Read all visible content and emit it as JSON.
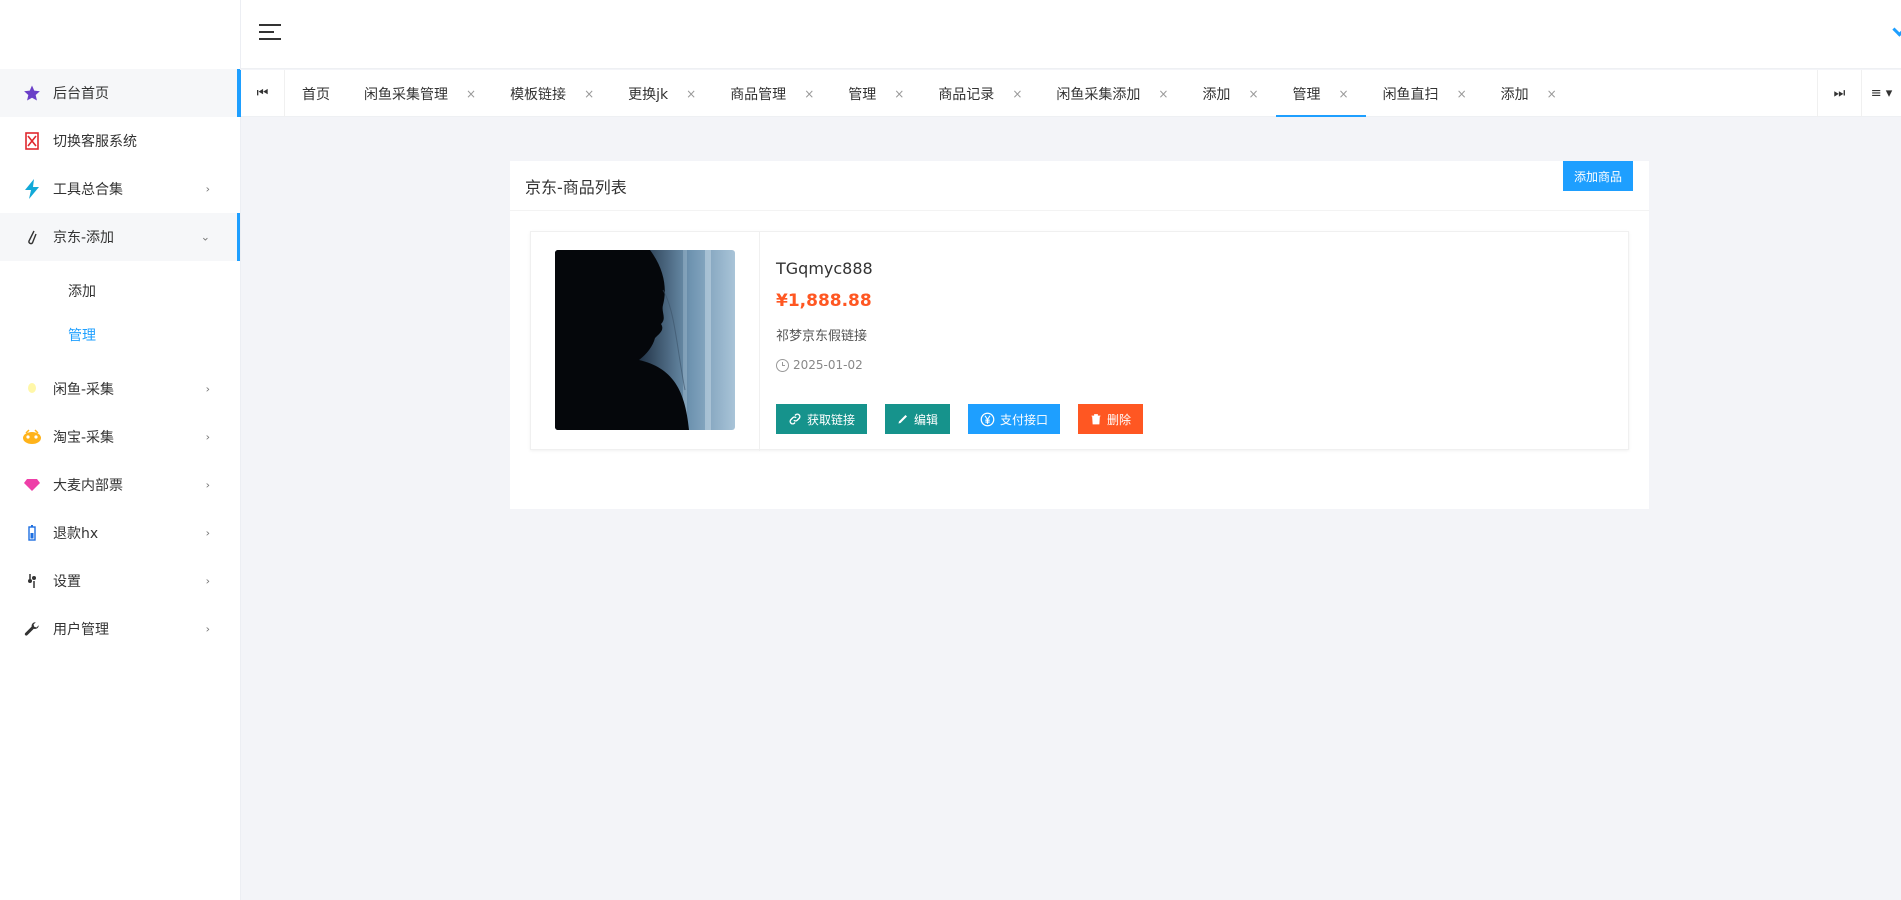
{
  "sidebar": {
    "items": [
      {
        "label": "后台首页",
        "icon": "star-icon",
        "has_arrow": false
      },
      {
        "label": "切换客服系统",
        "icon": "switch-icon",
        "has_arrow": false
      },
      {
        "label": "工具总合集",
        "icon": "lightning-icon",
        "has_arrow": true
      },
      {
        "label": "京东-添加",
        "icon": "paperclip-icon",
        "has_arrow": true,
        "expanded": true
      },
      {
        "label": "闲鱼-采集",
        "icon": "bulb-icon",
        "has_arrow": true
      },
      {
        "label": "淘宝-采集",
        "icon": "taobao-icon",
        "has_arrow": true
      },
      {
        "label": "大麦内部票",
        "icon": "diamond-icon",
        "has_arrow": true
      },
      {
        "label": "退款hx",
        "icon": "battery-icon",
        "has_arrow": true
      },
      {
        "label": "设置",
        "icon": "settings-icon",
        "has_arrow": true
      },
      {
        "label": "用户管理",
        "icon": "wrench-icon",
        "has_arrow": true
      }
    ],
    "sub_items": [
      {
        "label": "添加",
        "active": false
      },
      {
        "label": "管理",
        "active": true
      }
    ]
  },
  "tabs": [
    {
      "label": "首页",
      "closable": false
    },
    {
      "label": "闲鱼采集管理",
      "closable": true
    },
    {
      "label": "模板链接",
      "closable": true
    },
    {
      "label": "更换jk",
      "closable": true
    },
    {
      "label": "商品管理",
      "closable": true
    },
    {
      "label": "管理",
      "closable": true
    },
    {
      "label": "商品记录",
      "closable": true
    },
    {
      "label": "闲鱼采集添加",
      "closable": true
    },
    {
      "label": "添加",
      "closable": true
    },
    {
      "label": "管理",
      "closable": true,
      "active": true
    },
    {
      "label": "闲鱼直扫",
      "closable": true
    },
    {
      "label": "添加",
      "closable": true
    }
  ],
  "tab_close_glyph": "×",
  "card": {
    "title": "京东-商品列表",
    "add_button": "添加商品"
  },
  "product": {
    "name": "TGqmyc888",
    "price": "¥1,888.88",
    "description": "祁梦京东假链接",
    "date": "2025-01-02",
    "buttons": {
      "get_link": "获取链接",
      "edit": "编辑",
      "pay": "支付接口",
      "delete": "删除"
    }
  },
  "colors": {
    "accent": "#1e9fff",
    "teal": "#16938c",
    "price": "#ff5722",
    "delete": "#ff5722"
  }
}
